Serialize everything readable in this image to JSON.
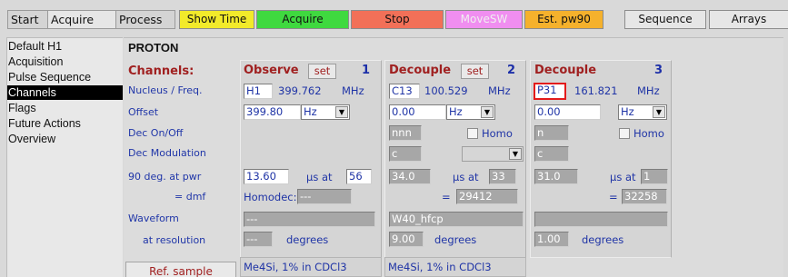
{
  "tabs": [
    "Start",
    "Acquire",
    "Process"
  ],
  "toolbar_buttons": [
    {
      "label": "Show Time",
      "color": "#f2ea2a"
    },
    {
      "label": "Acquire",
      "color": "#3fd93f"
    },
    {
      "label": "Stop",
      "color": "#f27058"
    },
    {
      "label": "MoveSW",
      "color": "#f08ef0",
      "disabled": true
    },
    {
      "label": "Est. pw90",
      "color": "#f5b12c"
    },
    {
      "label": "Sequence",
      "color": "#e6e6e6"
    },
    {
      "label": "Arrays",
      "color": "#e6e6e6"
    }
  ],
  "nav": {
    "items": [
      "Default H1",
      "Acquisition",
      "Pulse Sequence",
      "Channels",
      "Flags",
      "Future Actions",
      "Overview"
    ],
    "selected": "Channels"
  },
  "panel": {
    "title": "PROTON",
    "channels_label": "Channels:",
    "row_labels": {
      "nucleus": "Nucleus / Freq.",
      "offset": "Offset",
      "dec_onoff": "Dec On/Off",
      "dec_mod": "Dec Modulation",
      "pwr": "90 deg. at pwr",
      "dmf": "= dmf",
      "waveform": "Waveform",
      "resolution": "at resolution"
    },
    "ref_sample_label": "Ref. sample"
  },
  "observe": {
    "title": "Observe",
    "set_label": "set",
    "number": "1",
    "nucleus": "H1",
    "freq": "399.762",
    "freq_unit": "MHz",
    "offset": "399.80",
    "offset_unit": "Hz",
    "pw90": "13.60",
    "us_at": "µs at",
    "pwr": "56",
    "homodec_label": "Homodec:",
    "homodec": "---",
    "waveform": "---",
    "resolution": "---",
    "degrees": "degrees",
    "solvent": "Me4Si, 1% in CDCl3"
  },
  "decouple2": {
    "title": "Decouple",
    "set_label": "set",
    "number": "2",
    "nucleus": "C13",
    "freq": "100.529",
    "freq_unit": "MHz",
    "offset": "0.00",
    "offset_unit": "Hz",
    "dec_onoff": "nnn",
    "homo_label": "Homo",
    "dec_mod": "c",
    "pw90": "34.0",
    "us_at": "µs at",
    "pwr": "33",
    "equals": "=",
    "dmf": "29412",
    "waveform": "W40_hfcp",
    "resolution": "9.00",
    "degrees": "degrees",
    "solvent": "Me4Si, 1% in CDCl3"
  },
  "decouple3": {
    "title": "Decouple",
    "number": "3",
    "nucleus": "P31",
    "freq": "161.821",
    "freq_unit": "MHz",
    "offset": "0.00",
    "offset_unit": "Hz",
    "dec_onoff": "n",
    "homo_label": "Homo",
    "dec_mod": "c",
    "pw90": "31.0",
    "us_at": "µs at",
    "pwr": "1",
    "equals": "=",
    "dmf": "32258",
    "waveform": "",
    "resolution": "1.00",
    "degrees": "degrees"
  }
}
